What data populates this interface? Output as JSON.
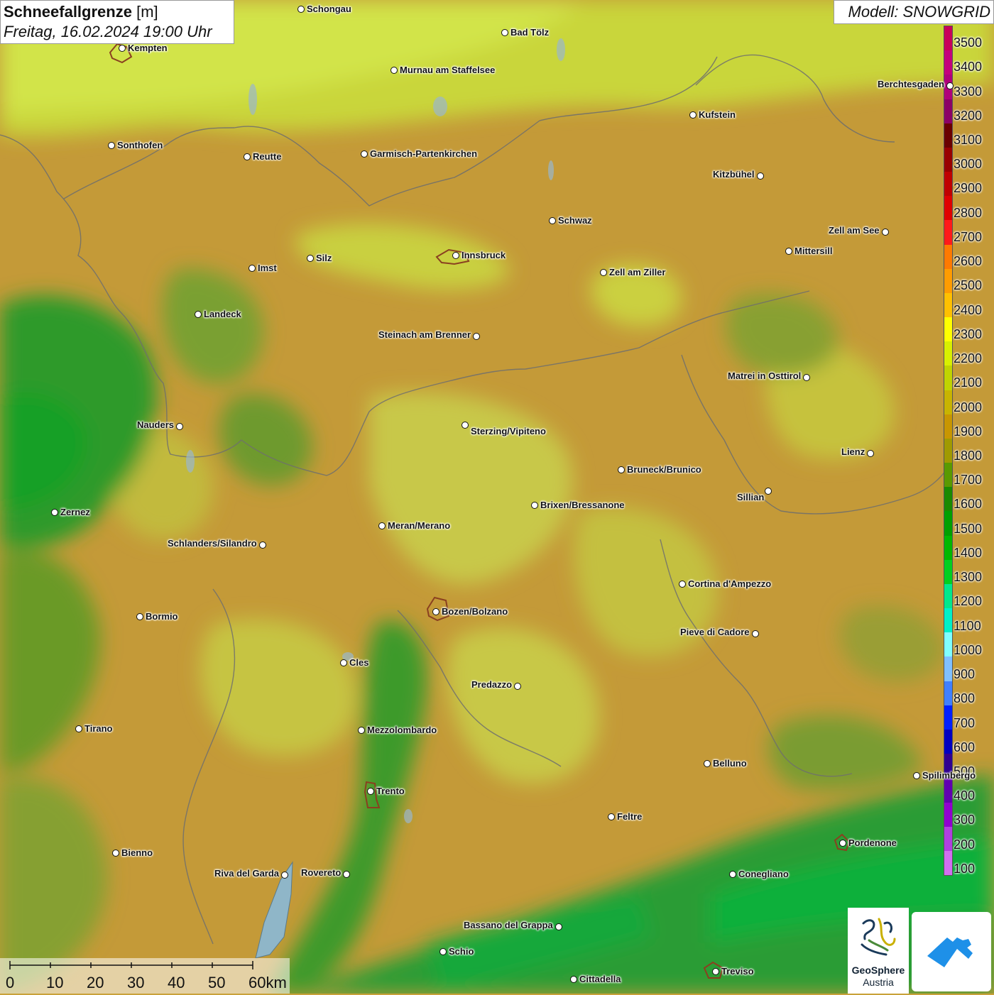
{
  "title": {
    "main": "Schneefallgrenze",
    "unit": "[m]",
    "datetime": "Freitag, 16.02.2024 19:00 Uhr"
  },
  "model_label": "Modell: SNOWGRID",
  "legend": {
    "unit": "m",
    "labels": [
      "3500",
      "3400",
      "3300",
      "3200",
      "3100",
      "3000",
      "2900",
      "2800",
      "2700",
      "2600",
      "2500",
      "2400",
      "2300",
      "2200",
      "2100",
      "2000",
      "1900",
      "1800",
      "1700",
      "1600",
      "1500",
      "1400",
      "1300",
      "1200",
      "1100",
      "1000",
      "900",
      "800",
      "700",
      "600",
      "500",
      "400",
      "300",
      "200",
      "100"
    ],
    "colors": [
      "#c8005a",
      "#c4007c",
      "#b0007a",
      "#8b0066",
      "#6a0000",
      "#990000",
      "#c00000",
      "#e00000",
      "#ff1a1a",
      "#ff7a00",
      "#ff9c00",
      "#ffc000",
      "#ffff00",
      "#d8f000",
      "#c0d400",
      "#c8b400",
      "#c89600",
      "#a09a00",
      "#5a9a00",
      "#1a8a00",
      "#00a000",
      "#00b800",
      "#00d020",
      "#00e88c",
      "#00f0c8",
      "#80ffff",
      "#80c0ff",
      "#4080ff",
      "#0020ff",
      "#0000c0",
      "#300090",
      "#6000b0",
      "#9000d0",
      "#b040e0",
      "#d070f0"
    ]
  },
  "cities": [
    {
      "name": "Schongau",
      "label_side": "right"
    },
    {
      "name": "Bad Tölz",
      "label_side": "right"
    },
    {
      "name": "Kempten",
      "label_side": "right"
    },
    {
      "name": "Murnau am Staffelsee",
      "label_side": "right"
    },
    {
      "name": "Kufstein",
      "label_side": "right"
    },
    {
      "name": "Berchtesgaden",
      "label_side": "left"
    },
    {
      "name": "Sonthofen",
      "label_side": "right"
    },
    {
      "name": "Reutte",
      "label_side": "right"
    },
    {
      "name": "Garmisch-Partenkirchen",
      "label_side": "right"
    },
    {
      "name": "Kitzbühel",
      "label_side": "left"
    },
    {
      "name": "Schwaz",
      "label_side": "right"
    },
    {
      "name": "Zell am See",
      "label_side": "left"
    },
    {
      "name": "Innsbruck",
      "label_side": "right"
    },
    {
      "name": "Silz",
      "label_side": "right"
    },
    {
      "name": "Mittersill",
      "label_side": "right"
    },
    {
      "name": "Imst",
      "label_side": "right"
    },
    {
      "name": "Zell am Ziller",
      "label_side": "right"
    },
    {
      "name": "Landeck",
      "label_side": "right"
    },
    {
      "name": "Steinach am Brenner",
      "label_side": "left"
    },
    {
      "name": "Matrei in Osttirol",
      "label_side": "left"
    },
    {
      "name": "Nauders",
      "label_side": "left"
    },
    {
      "name": "Sterzing/Vipiteno",
      "label_side": "right-below"
    },
    {
      "name": "Lienz",
      "label_side": "left"
    },
    {
      "name": "Bruneck/Brunico",
      "label_side": "right"
    },
    {
      "name": "Sillian",
      "label_side": "left-below"
    },
    {
      "name": "Brixen/Bressanone",
      "label_side": "right"
    },
    {
      "name": "Zernez",
      "label_side": "right"
    },
    {
      "name": "Meran/Merano",
      "label_side": "right"
    },
    {
      "name": "Schlanders/Silandro",
      "label_side": "left"
    },
    {
      "name": "Cortina d'Ampezzo",
      "label_side": "right"
    },
    {
      "name": "Bozen/Bolzano",
      "label_side": "right"
    },
    {
      "name": "Bormio",
      "label_side": "right"
    },
    {
      "name": "Pieve di Cadore",
      "label_side": "left"
    },
    {
      "name": "Cles",
      "label_side": "right"
    },
    {
      "name": "Predazzo",
      "label_side": "left"
    },
    {
      "name": "Tirano",
      "label_side": "right"
    },
    {
      "name": "Mezzolombardo",
      "label_side": "right"
    },
    {
      "name": "Belluno",
      "label_side": "right"
    },
    {
      "name": "Trento",
      "label_side": "right"
    },
    {
      "name": "Feltre",
      "label_side": "right"
    },
    {
      "name": "Pordenone",
      "label_side": "right"
    },
    {
      "name": "Bienno",
      "label_side": "right"
    },
    {
      "name": "Riva del Garda",
      "label_side": "left"
    },
    {
      "name": "Rovereto",
      "label_side": "left"
    },
    {
      "name": "Conegliano",
      "label_side": "right"
    },
    {
      "name": "Bassano del Grappa",
      "label_side": "left"
    },
    {
      "name": "Schio",
      "label_side": "right"
    },
    {
      "name": "Treviso",
      "label_side": "right"
    },
    {
      "name": "Cittadella",
      "label_side": "right"
    },
    {
      "name": "Spilimbergo",
      "label_side": "right"
    }
  ],
  "scalebar": {
    "labels": [
      "0",
      "10",
      "20",
      "30",
      "40",
      "50",
      "60km"
    ]
  },
  "logos": {
    "geosphere_line1": "GeoSphere",
    "geosphere_line2": "Austria"
  }
}
